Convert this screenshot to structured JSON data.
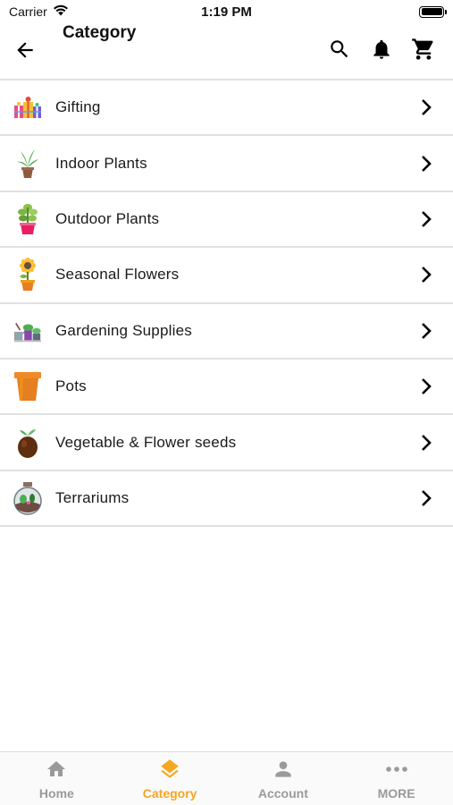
{
  "status_bar": {
    "carrier": "Carrier",
    "time": "1:19 PM"
  },
  "header": {
    "title": "Category"
  },
  "categories": [
    {
      "label": "Gifting",
      "icon": "gift-box-icon"
    },
    {
      "label": "Indoor Plants",
      "icon": "indoor-plant-icon"
    },
    {
      "label": "Outdoor Plants",
      "icon": "outdoor-plant-icon"
    },
    {
      "label": "Seasonal Flowers",
      "icon": "sunflower-pot-icon"
    },
    {
      "label": "Gardening Supplies",
      "icon": "gardening-tools-icon"
    },
    {
      "label": "Pots",
      "icon": "clay-pot-icon"
    },
    {
      "label": "Vegetable & Flower seeds",
      "icon": "seed-icon"
    },
    {
      "label": "Terrariums",
      "icon": "terrarium-icon"
    }
  ],
  "bottom_nav": [
    {
      "label": "Home",
      "icon": "home-icon",
      "active": false
    },
    {
      "label": "Category",
      "icon": "layers-icon",
      "active": true
    },
    {
      "label": "Account",
      "icon": "person-icon",
      "active": false
    },
    {
      "label": "MORE",
      "icon": "more-dots-icon",
      "active": false
    }
  ],
  "colors": {
    "accent": "#f5a623",
    "inactive": "#9a9a9a",
    "divider": "#e1e1e1"
  }
}
